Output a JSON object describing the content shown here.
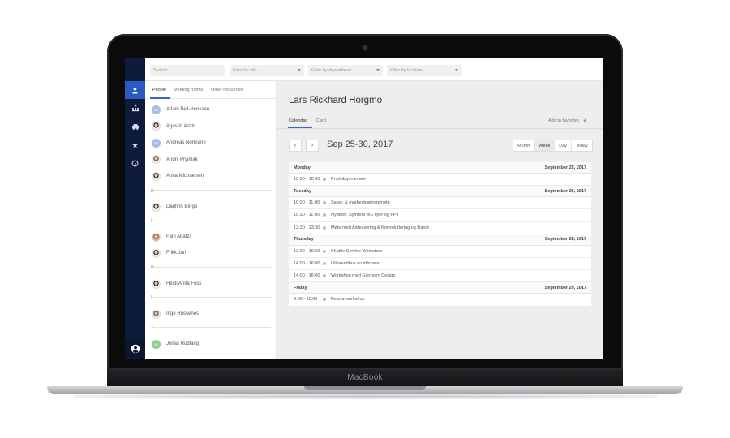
{
  "device": {
    "brand": "MacBook"
  },
  "filters": {
    "search_placeholder": "Search",
    "city": "Filter by city",
    "department": "Filter by department",
    "location": "Filter by location"
  },
  "nav": {
    "icons": [
      "person-icon",
      "org-chart-icon",
      "car-icon",
      "star-icon",
      "clock-icon",
      "account-circle-icon"
    ],
    "active_index": 0
  },
  "people_tabs": [
    "People",
    "Meeting rooms",
    "Other resources"
  ],
  "people": {
    "group_a": [
      {
        "name": "Adam Bell-Hanssen",
        "initials": "AB"
      },
      {
        "name": "Agustin Arizti",
        "initials": ""
      },
      {
        "name": "Andreas Normann",
        "initials": "AN"
      },
      {
        "name": "Andrii Pryimak",
        "initials": ""
      },
      {
        "name": "Anna Michaelsen",
        "initials": ""
      }
    ],
    "letters": [
      "D",
      "F",
      "H",
      "I",
      "J"
    ],
    "group_d": [
      {
        "name": "Dagfinn Berge",
        "initials": ""
      }
    ],
    "group_f": [
      {
        "name": "Fani Abatzi",
        "initials": ""
      },
      {
        "name": "Frikk Jarl",
        "initials": ""
      }
    ],
    "group_h": [
      {
        "name": "Heidi Anita Foss",
        "initials": ""
      }
    ],
    "group_i": [
      {
        "name": "Inge Russenes",
        "initials": ""
      }
    ],
    "group_j": [
      {
        "name": "Jonas Rudlang",
        "initials": "JR"
      }
    ]
  },
  "detail": {
    "name": "Lars Rickhard Horgmo",
    "tabs": [
      "Calendar",
      "Card"
    ],
    "favorites_label": "Add to favorites",
    "prev": "‹",
    "next": "›",
    "range": "Sep 25-30, 2017",
    "views": [
      "Month",
      "Week",
      "Day",
      "Today"
    ],
    "active_view": "Week"
  },
  "calendar": [
    {
      "day": "Monday",
      "date": "September 25, 2017",
      "events": [
        {
          "time": "10:00 - 10:45",
          "title": "Produksjonsmøte"
        }
      ]
    },
    {
      "day": "Tuesday",
      "date": "September 26, 2017",
      "events": [
        {
          "time": "10:00 - 11:00",
          "title": "Salgs- & markedsføringsmøte"
        },
        {
          "time": "10:30 - 11:00",
          "title": "Ny brief: Symfoni WE flyer og PPT"
        },
        {
          "time": "12:30 - 13:30",
          "title": "Møte med Adressering & Konvoluttering og Randi"
        }
      ]
    },
    {
      "day": "Thursday",
      "date": "September 28, 2017",
      "events": [
        {
          "time": "12:00 - 16:00",
          "title": "Shuttle Service Workshop"
        },
        {
          "time": "14:00 - 16:00",
          "title": "Lillesandhus.no idémøte"
        },
        {
          "time": "14:00 - 16:00",
          "title": "Workshop med Gjerholm Design"
        }
      ]
    },
    {
      "day": "Friday",
      "date": "September 29, 2017",
      "events": [
        {
          "time": "9:00 - 10:00",
          "title": "Retura workshop"
        }
      ]
    }
  ]
}
